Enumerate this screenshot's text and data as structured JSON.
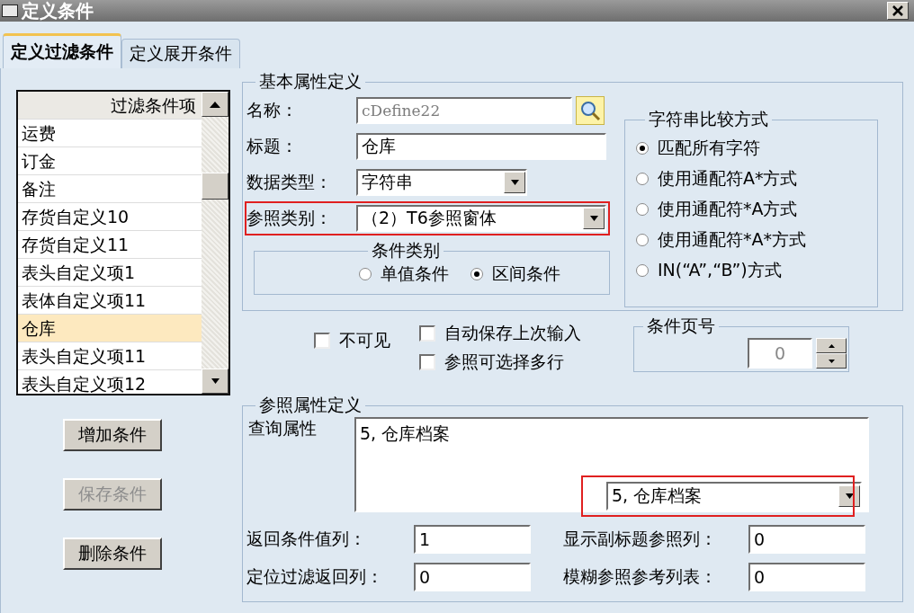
{
  "window": {
    "title": "定义条件"
  },
  "tabs": [
    {
      "label": "定义过滤条件",
      "selected": true
    },
    {
      "label": "定义展开条件",
      "selected": false
    }
  ],
  "condition_list": {
    "header": "过滤条件项",
    "items": [
      {
        "label": "运费",
        "selected": false
      },
      {
        "label": "订金",
        "selected": false
      },
      {
        "label": "备注",
        "selected": false
      },
      {
        "label": "存货自定义10",
        "selected": false
      },
      {
        "label": "存货自定义11",
        "selected": false
      },
      {
        "label": "表头自定义项1",
        "selected": false
      },
      {
        "label": "表体自定义项11",
        "selected": false
      },
      {
        "label": "仓库",
        "selected": true
      },
      {
        "label": "表头自定义项11",
        "selected": false
      },
      {
        "label": "表头自定义项12",
        "selected": false
      }
    ]
  },
  "buttons": [
    {
      "label": "增加条件",
      "disabled": false
    },
    {
      "label": "保存条件",
      "disabled": true
    },
    {
      "label": "删除条件",
      "disabled": false
    }
  ],
  "basic": {
    "title": "基本属性定义",
    "fields": [
      {
        "kind": "lookup",
        "label": "名称：",
        "value": "cDefine22",
        "disabled": true,
        "highlighted": false
      },
      {
        "kind": "text",
        "label": "标题：",
        "value": "仓库",
        "disabled": false,
        "highlighted": false
      },
      {
        "kind": "select",
        "label": "数据类型：",
        "value": "字符串",
        "disabled": false,
        "highlighted": false
      },
      {
        "kind": "select",
        "label": "参照类别：",
        "value": "（2）T6参照窗体",
        "disabled": false,
        "highlighted": true
      }
    ],
    "condition_type": {
      "title": "条件类别",
      "options": [
        {
          "label": "单值条件",
          "selected": false
        },
        {
          "label": "区间条件",
          "selected": true
        }
      ]
    }
  },
  "string_compare": {
    "title": "字符串比较方式",
    "options": [
      {
        "label": "匹配所有字符",
        "selected": true
      },
      {
        "label": "使用通配符A*方式",
        "selected": false
      },
      {
        "label": "使用通配符*A方式",
        "selected": false
      },
      {
        "label": "使用通配符*A*方式",
        "selected": false
      },
      {
        "label": "IN(“A”,“B”)方式",
        "selected": false
      }
    ]
  },
  "checkboxes": [
    {
      "label": "不可见",
      "checked": false
    },
    {
      "label": "自动保存上次输入",
      "checked": false
    },
    {
      "label": "参照可选择多行",
      "checked": false
    }
  ],
  "page_number": {
    "title": "条件页号",
    "value": "0"
  },
  "reference": {
    "title": "参照属性定义",
    "query_label": "查询属性",
    "query_text": "5, 仓库档案",
    "query_select": {
      "value": "5, 仓库档案",
      "highlighted": true
    },
    "fields": [
      {
        "label": "返回条件值列：",
        "value": "1"
      },
      {
        "label": "显示副标题参照列：",
        "value": "0"
      },
      {
        "label": "定位过滤返回列：",
        "value": "0"
      },
      {
        "label": "模糊参照参考列表：",
        "value": "0"
      }
    ]
  }
}
